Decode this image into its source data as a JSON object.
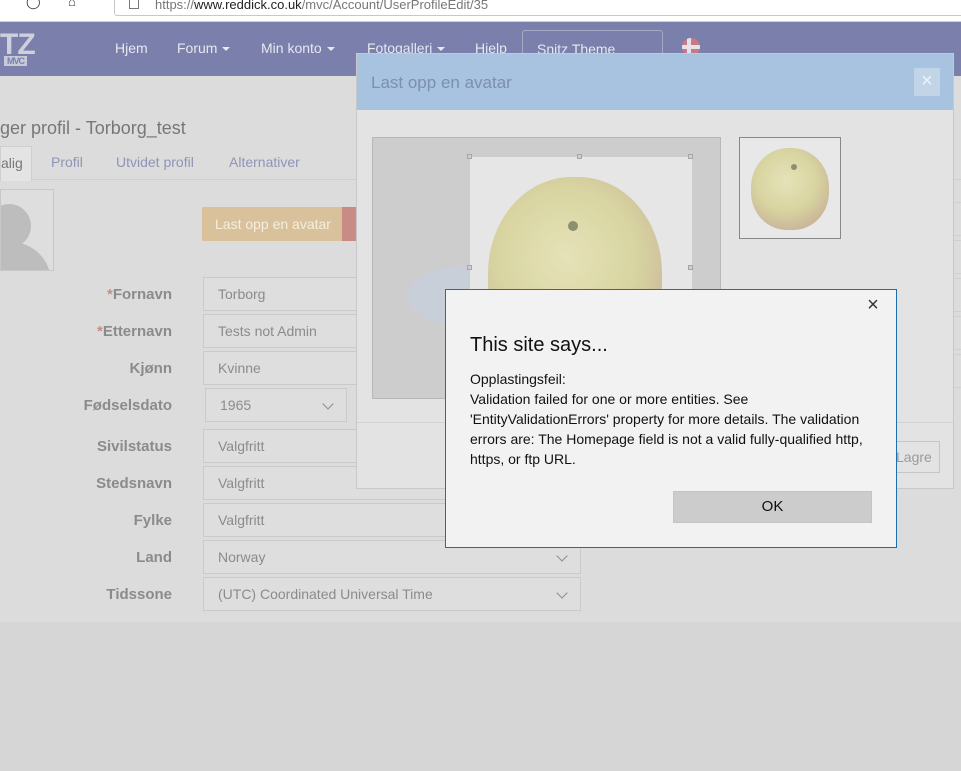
{
  "browser": {
    "url_prefix": "https://",
    "url_domain": "www.reddick.co.uk",
    "url_path": "/mvc/Account/UserProfileEdit/35"
  },
  "nav": {
    "logo_text": "TZ",
    "logo_sub": "MVC",
    "items": [
      {
        "label": "Hjem",
        "dropdown": false
      },
      {
        "label": "Forum",
        "dropdown": true
      },
      {
        "label": "Min konto",
        "dropdown": true
      },
      {
        "label": "Fotogalleri",
        "dropdown": true
      },
      {
        "label": "Hjelp",
        "dropdown": false
      }
    ],
    "theme_select": "Snitz Theme"
  },
  "page": {
    "title": "ger profil - Torborg_test",
    "tabs": [
      "alig",
      "Profil",
      "Utvidet profil",
      "Alternativer"
    ],
    "upload_button": "Last opp en avatar"
  },
  "form": {
    "fields": [
      {
        "label": "Fornavn",
        "required": true,
        "value": "Torborg",
        "type": "text"
      },
      {
        "label": "Etternavn",
        "required": true,
        "value": "Tests not Admin",
        "type": "text"
      },
      {
        "label": "Kjønn",
        "required": false,
        "value": "Kvinne",
        "type": "text"
      },
      {
        "label": "Fødselsdato",
        "required": false,
        "value": "1965",
        "type": "select"
      },
      {
        "label": "Sivilstatus",
        "required": false,
        "value": "Valgfritt",
        "type": "text"
      },
      {
        "label": "Stedsnavn",
        "required": false,
        "value": "Valgfritt",
        "type": "text"
      },
      {
        "label": "Fylke",
        "required": false,
        "value": "Valgfritt",
        "type": "text"
      },
      {
        "label": "Land",
        "required": false,
        "value": "Norway",
        "type": "select"
      },
      {
        "label": "Tidssone",
        "required": false,
        "value": "(UTC) Coordinated Universal Time",
        "type": "select"
      }
    ]
  },
  "avatar_modal": {
    "title": "Last opp en avatar",
    "close": "×",
    "save_label": "Lagre"
  },
  "alert": {
    "title": "This site says...",
    "close": "×",
    "line1": "Opplastingsfeil:",
    "message": "Validation failed for one or more entities. See 'EntityValidationErrors' property for more details. The validation errors are: The Homepage field is not a valid fully-qualified http, https, or ftp URL.",
    "ok_label": "OK"
  },
  "colors": {
    "nav_bg": "#7a7fab",
    "modal_header": "#a8c3df",
    "alert_border": "#1a6fb3",
    "upload_button": "#d9c19b"
  }
}
